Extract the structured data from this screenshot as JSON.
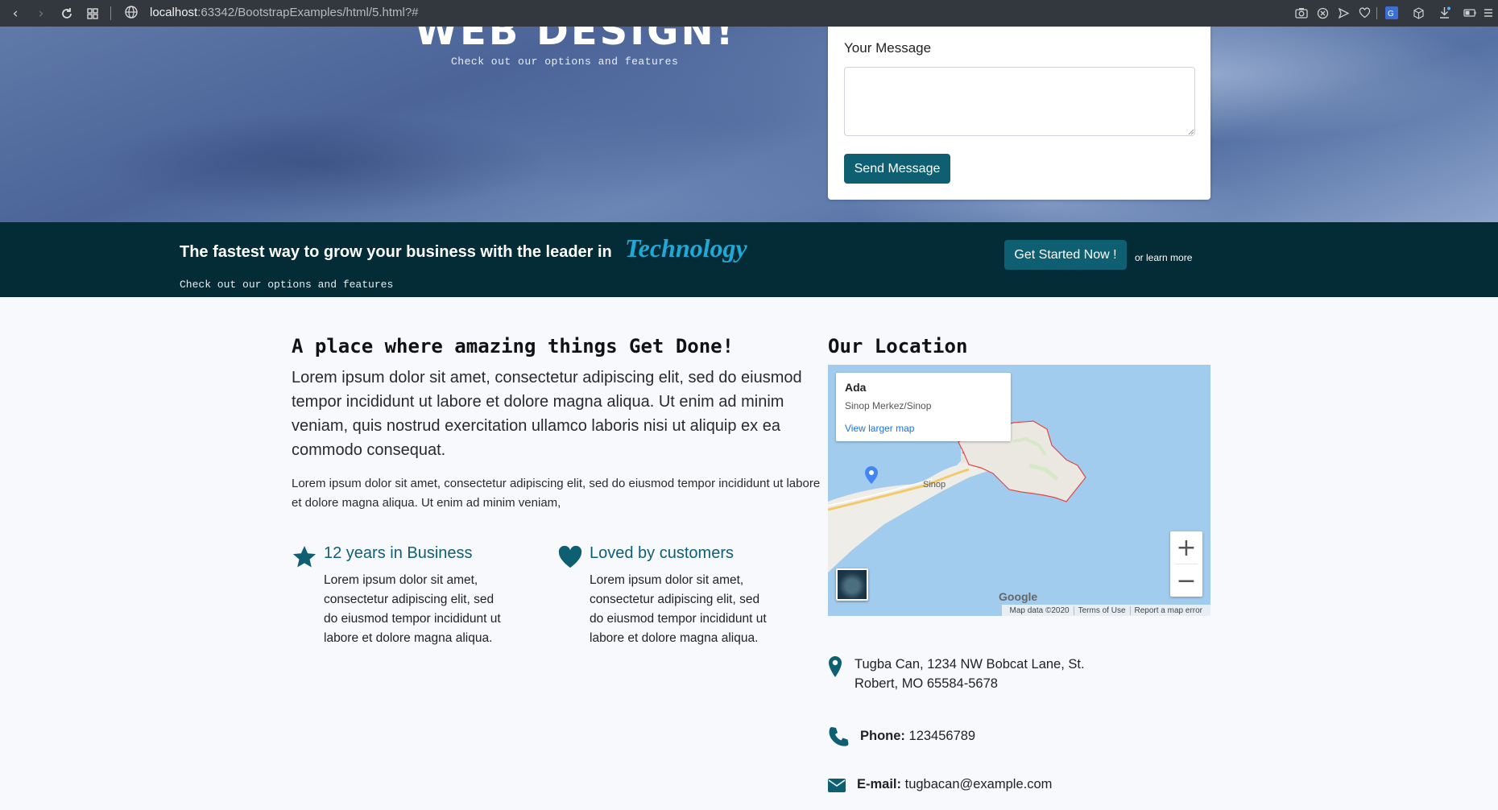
{
  "browser": {
    "url_host": "localhost",
    "url_path": ":63342/BootstrapExamples/html/5.html?#"
  },
  "hero": {
    "title": "WEB DESIGN!",
    "subtitle": "Check out our options and features",
    "form": {
      "message_label": "Your Message",
      "message_value": "",
      "send_label": "Send Message"
    }
  },
  "band": {
    "text": "The fastest way to grow your business with the leader in",
    "accent": "Technology",
    "subtitle": "Check out our options and features",
    "cta_label": "Get Started Now !",
    "learn_more": "or learn more"
  },
  "about": {
    "heading_plain": "A place where amazing things ",
    "heading_bold": "Get Done!",
    "lead": "Lorem ipsum dolor sit amet, consectetur adipiscing elit, sed do eiusmod tempor incididunt ut labore et dolore magna aliqua. Ut enim ad minim veniam, quis nostrud exercitation ullamco laboris nisi ut aliquip ex ea commodo consequat.",
    "paragraph": "Lorem ipsum dolor sit amet, consectetur adipiscing elit, sed do eiusmod tempor incididunt ut labore et dolore magna aliqua. Ut enim ad minim veniam,",
    "features": [
      {
        "title": "12 years in Business",
        "text": "Lorem ipsum dolor sit amet, consectetur adipiscing elit, sed do eiusmod tempor incididunt ut labore et dolore magna aliqua.",
        "icon": "star-icon"
      },
      {
        "title": "Loved by customers",
        "text": "Lorem ipsum dolor sit amet, consectetur adipiscing elit, sed do eiusmod tempor incididunt ut labore et dolore magna aliqua.",
        "icon": "heart-icon"
      }
    ]
  },
  "location": {
    "heading_plain": "Our ",
    "heading_bold": "Location",
    "map": {
      "place_name": "Ada",
      "place_sub": "Sinop Merkez/Sinop",
      "larger_map": "View larger map",
      "city_label": "Sinop",
      "zoom_in": "+",
      "zoom_out": "−",
      "brand": "Google",
      "footer": [
        "Map data ©2020",
        "Terms of Use",
        "Report a map error"
      ]
    },
    "address": "Tugba Can, 1234 NW Bobcat Lane, St. Robert, MO 65584-5678",
    "phone_label": "Phone:",
    "phone": "123456789",
    "email_label": "E-mail:",
    "email": "tugbacan@example.com"
  },
  "colors": {
    "primary": "#0f5f73",
    "band_bg": "#042c37",
    "accent": "#1ea9d6"
  }
}
